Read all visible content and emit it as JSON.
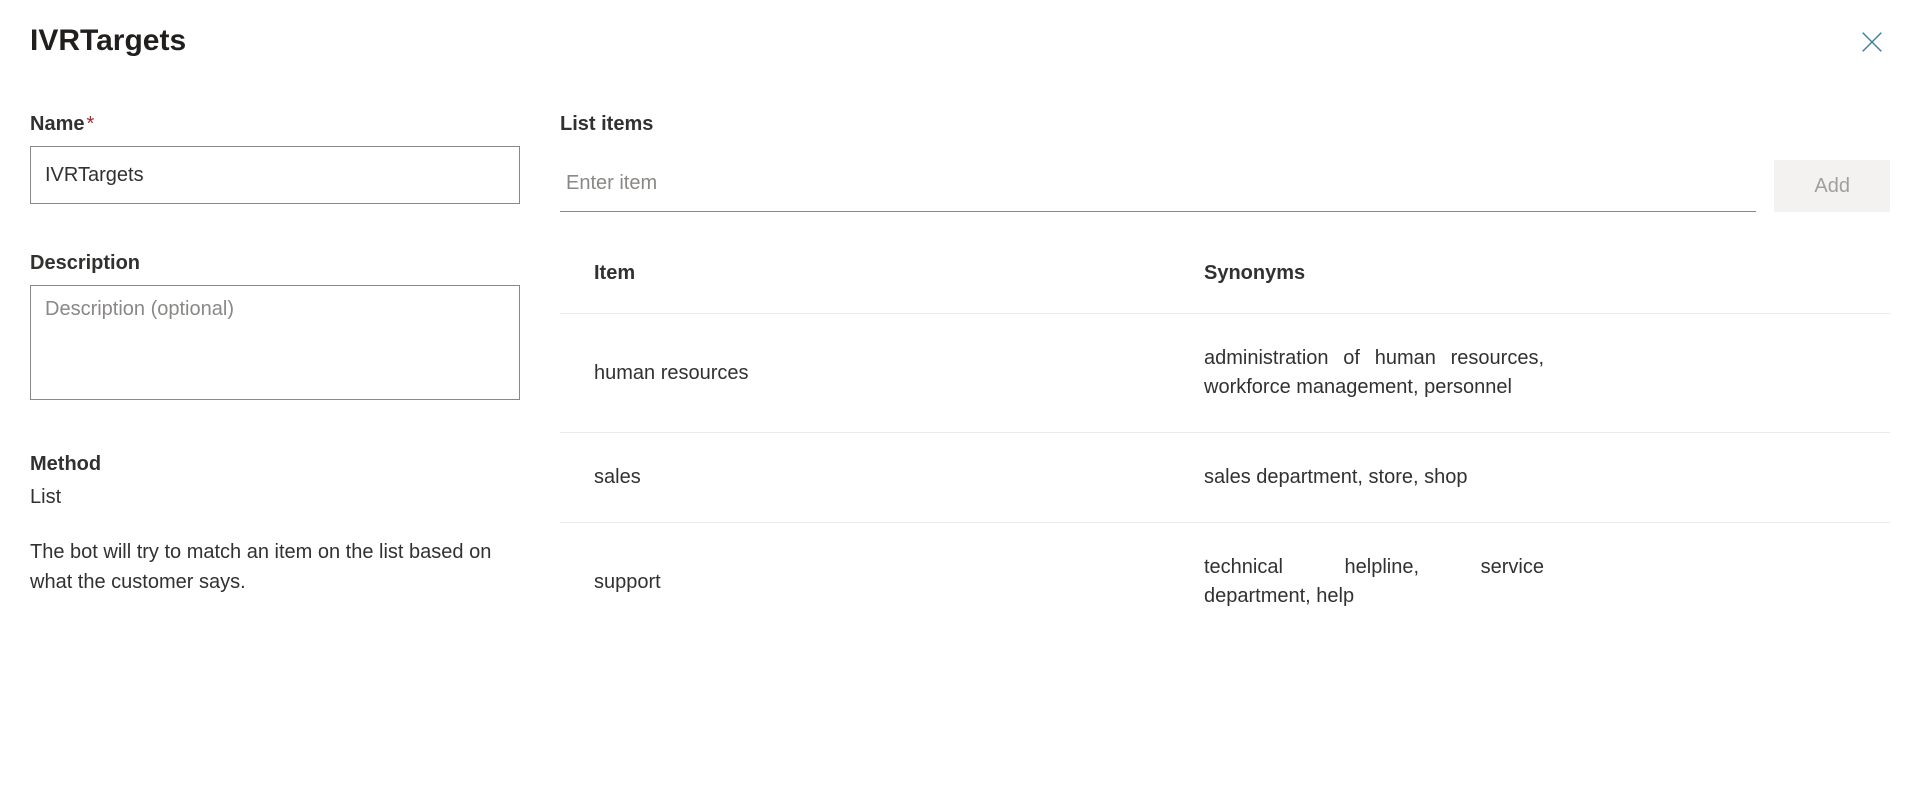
{
  "header": {
    "title": "IVRTargets"
  },
  "left": {
    "name_label": "Name",
    "name_value": "IVRTargets",
    "description_label": "Description",
    "description_placeholder": "Description (optional)",
    "description_value": "",
    "method_label": "Method",
    "method_value": "List",
    "method_description": "The bot will try to match an item on the list based on what the customer says."
  },
  "right": {
    "list_items_label": "List items",
    "enter_item_placeholder": "Enter item",
    "add_button_label": "Add",
    "columns": {
      "item": "Item",
      "synonyms": "Synonyms"
    },
    "rows": [
      {
        "item": "human resources",
        "synonyms": "administration of human resources, workforce management, personnel"
      },
      {
        "item": "sales",
        "synonyms": "sales department, store, shop"
      },
      {
        "item": "support",
        "synonyms": "technical helpline, service department, help"
      }
    ]
  }
}
